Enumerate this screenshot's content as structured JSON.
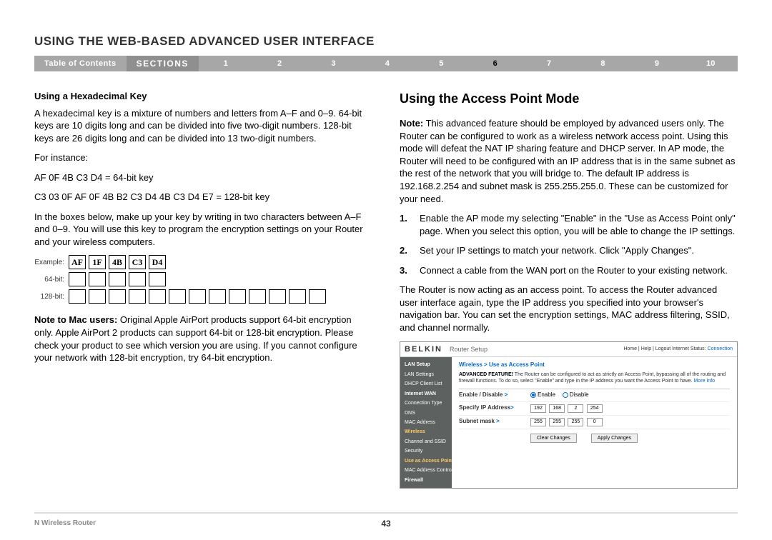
{
  "page_title": "USING THE WEB-BASED ADVANCED USER INTERFACE",
  "nav": {
    "toc": "Table of Contents",
    "sections_label": "SECTIONS",
    "numbers": [
      "1",
      "2",
      "3",
      "4",
      "5",
      "6",
      "7",
      "8",
      "9",
      "10"
    ],
    "active": "6"
  },
  "left": {
    "heading": "Using a Hexadecimal Key",
    "p1": "A hexadecimal key is a mixture of numbers and letters from A–F and 0–9. 64-bit keys are 10 digits long and can be divided into five two-digit numbers. 128-bit keys are 26 digits long and can be divided into 13 two-digit numbers.",
    "p2": "For instance:",
    "p3": "AF 0F 4B C3 D4 = 64-bit key",
    "p4": "C3 03 0F AF 0F 4B B2 C3 D4 4B C3 D4 E7 = 128-bit key",
    "p5": "In the boxes below, make up your key by writing in two characters between A–F and 0–9. You will use this key to program the encryption settings on your Router and your wireless computers.",
    "hex": {
      "row_labels": [
        "Example:",
        "64-bit:",
        "128-bit:"
      ],
      "example_values": [
        "AF",
        "1F",
        "4B",
        "C3",
        "D4"
      ]
    },
    "note_label": "Note to Mac users:",
    "note_body": " Original Apple AirPort products support 64-bit encryption only. Apple AirPort 2 products can support 64-bit or 128-bit encryption. Please check your product to see which version you are using. If you cannot configure your network with 128-bit encryption, try 64-bit encryption."
  },
  "right": {
    "heading": "Using the Access Point Mode",
    "note_label": "Note:",
    "note_body": " This advanced feature should be employed by advanced users only. The Router can be configured to work as a wireless network access point. Using this mode will defeat the NAT IP sharing feature and DHCP server. In AP mode, the Router will need to be configured with an IP address that is in the same subnet as the rest of the network that you will bridge to. The default IP address is 192.168.2.254 and subnet mask is 255.255.255.0. These can be customized for your need.",
    "steps": [
      "Enable the AP mode my selecting \"Enable\" in the \"Use as Access Point only\" page. When you select this option, you will be able to change the IP settings.",
      "Set your IP settings to match your network. Click \"Apply Changes\".",
      "Connect a cable from the WAN port on the Router to your existing network."
    ],
    "p_after": "The Router is now acting as an access point. To access the Router advanced user interface again, type the IP address you specified into your browser's navigation bar. You can set the encryption settings, MAC address filtering, SSID, and channel normally."
  },
  "router": {
    "brand": "BELKIN",
    "subtitle": "Router Setup",
    "top_links": "Home | Help | Logout   Internet Status:",
    "conn": "Connection",
    "side": {
      "items": [
        {
          "t": "LAN Setup",
          "cls": "hd"
        },
        {
          "t": "LAN Settings",
          "cls": ""
        },
        {
          "t": "DHCP Client List",
          "cls": ""
        },
        {
          "t": "Internet WAN",
          "cls": "hd"
        },
        {
          "t": "Connection Type",
          "cls": ""
        },
        {
          "t": "DNS",
          "cls": ""
        },
        {
          "t": "MAC Address",
          "cls": ""
        },
        {
          "t": "Wireless",
          "cls": "hl"
        },
        {
          "t": "Channel and SSID",
          "cls": ""
        },
        {
          "t": "Security",
          "cls": ""
        },
        {
          "t": "Use as Access Point",
          "cls": "hl"
        },
        {
          "t": "MAC Address Control",
          "cls": ""
        },
        {
          "t": "Firewall",
          "cls": "hd"
        }
      ]
    },
    "crumb": "Wireless > Use as Access Point",
    "adv_label": "ADVANCED FEATURE!",
    "adv_body": " The Router can be configured to act as strictly an Access Point, bypassing all of the routing and firewall functions. To do so, select \"Enable\" and type in the IP address you want the Access Point to have.",
    "more": "More Info",
    "rows": {
      "enable_label": "Enable / Disable",
      "enable_opt": "Enable",
      "disable_opt": "Disable",
      "ip_label": "Specify IP Address",
      "ip": [
        "192",
        "168",
        "2",
        "254"
      ],
      "mask_label": "Subnet mask",
      "mask": [
        "255",
        "255",
        "255",
        "0"
      ]
    },
    "btn_clear": "Clear Changes",
    "btn_apply": "Apply Changes"
  },
  "footer": {
    "left": "N Wireless Router",
    "page": "43"
  }
}
